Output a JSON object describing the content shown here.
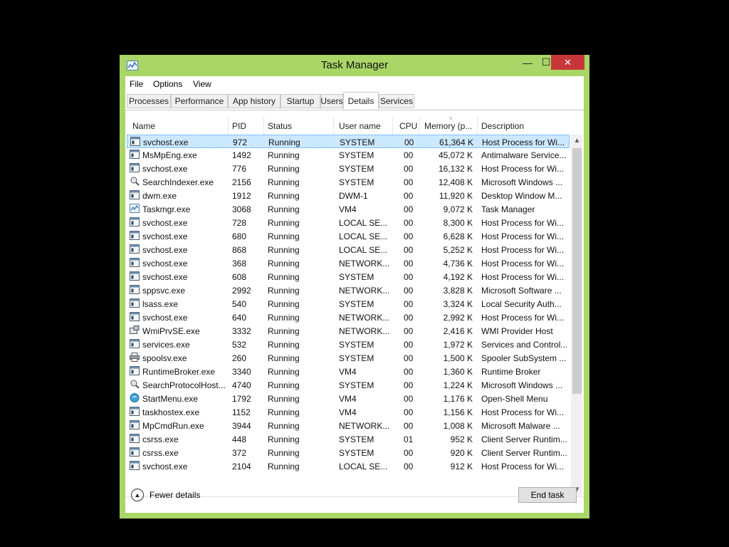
{
  "window": {
    "title": "Task Manager",
    "controls": {
      "minimize": "—",
      "maximize": "☐",
      "close": "✕"
    }
  },
  "menu": [
    "File",
    "Options",
    "View"
  ],
  "tabs": [
    "Processes",
    "Performance",
    "App history",
    "Startup",
    "Users",
    "Details",
    "Services"
  ],
  "active_tab": "Details",
  "columns": [
    "Name",
    "PID",
    "Status",
    "User name",
    "CPU",
    "Memory (p...",
    "Description"
  ],
  "rows": [
    {
      "icon": "service-host-icon",
      "name": "svchost.exe",
      "pid": "972",
      "status": "Running",
      "user": "SYSTEM",
      "cpu": "00",
      "mem": "61,364 K",
      "desc": "Host Process for Wi..."
    },
    {
      "icon": "service-host-icon",
      "name": "MsMpEng.exe",
      "pid": "1492",
      "status": "Running",
      "user": "SYSTEM",
      "cpu": "00",
      "mem": "45,072 K",
      "desc": "Antimalware Service..."
    },
    {
      "icon": "service-host-icon",
      "name": "svchost.exe",
      "pid": "776",
      "status": "Running",
      "user": "SYSTEM",
      "cpu": "00",
      "mem": "16,132 K",
      "desc": "Host Process for Wi..."
    },
    {
      "icon": "search-indexer-icon",
      "name": "SearchIndexer.exe",
      "pid": "2156",
      "status": "Running",
      "user": "SYSTEM",
      "cpu": "00",
      "mem": "12,408 K",
      "desc": "Microsoft Windows ..."
    },
    {
      "icon": "service-host-icon",
      "name": "dwm.exe",
      "pid": "1912",
      "status": "Running",
      "user": "DWM-1",
      "cpu": "00",
      "mem": "11,920 K",
      "desc": "Desktop Window M..."
    },
    {
      "icon": "task-manager-icon",
      "name": "Taskmgr.exe",
      "pid": "3068",
      "status": "Running",
      "user": "VM4",
      "cpu": "00",
      "mem": "9,072 K",
      "desc": "Task Manager"
    },
    {
      "icon": "service-host-icon",
      "name": "svchost.exe",
      "pid": "728",
      "status": "Running",
      "user": "LOCAL SE...",
      "cpu": "00",
      "mem": "8,300 K",
      "desc": "Host Process for Wi..."
    },
    {
      "icon": "service-host-icon",
      "name": "svchost.exe",
      "pid": "680",
      "status": "Running",
      "user": "LOCAL SE...",
      "cpu": "00",
      "mem": "6,628 K",
      "desc": "Host Process for Wi..."
    },
    {
      "icon": "service-host-icon",
      "name": "svchost.exe",
      "pid": "868",
      "status": "Running",
      "user": "LOCAL SE...",
      "cpu": "00",
      "mem": "5,252 K",
      "desc": "Host Process for Wi..."
    },
    {
      "icon": "service-host-icon",
      "name": "svchost.exe",
      "pid": "368",
      "status": "Running",
      "user": "NETWORK...",
      "cpu": "00",
      "mem": "4,736 K",
      "desc": "Host Process for Wi..."
    },
    {
      "icon": "service-host-icon",
      "name": "svchost.exe",
      "pid": "608",
      "status": "Running",
      "user": "SYSTEM",
      "cpu": "00",
      "mem": "4,192 K",
      "desc": "Host Process for Wi..."
    },
    {
      "icon": "service-host-icon",
      "name": "sppsvc.exe",
      "pid": "2992",
      "status": "Running",
      "user": "NETWORK...",
      "cpu": "00",
      "mem": "3,828 K",
      "desc": "Microsoft Software ..."
    },
    {
      "icon": "service-host-icon",
      "name": "lsass.exe",
      "pid": "540",
      "status": "Running",
      "user": "SYSTEM",
      "cpu": "00",
      "mem": "3,324 K",
      "desc": "Local Security Auth..."
    },
    {
      "icon": "service-host-icon",
      "name": "svchost.exe",
      "pid": "640",
      "status": "Running",
      "user": "NETWORK...",
      "cpu": "00",
      "mem": "2,992 K",
      "desc": "Host Process for Wi..."
    },
    {
      "icon": "wmi-provider-icon",
      "name": "WmiPrvSE.exe",
      "pid": "3332",
      "status": "Running",
      "user": "NETWORK...",
      "cpu": "00",
      "mem": "2,416 K",
      "desc": "WMI Provider Host"
    },
    {
      "icon": "service-host-icon",
      "name": "services.exe",
      "pid": "532",
      "status": "Running",
      "user": "SYSTEM",
      "cpu": "00",
      "mem": "1,972 K",
      "desc": "Services and Control..."
    },
    {
      "icon": "printer-icon",
      "name": "spoolsv.exe",
      "pid": "260",
      "status": "Running",
      "user": "SYSTEM",
      "cpu": "00",
      "mem": "1,500 K",
      "desc": "Spooler SubSystem ..."
    },
    {
      "icon": "service-host-icon",
      "name": "RuntimeBroker.exe",
      "pid": "3340",
      "status": "Running",
      "user": "VM4",
      "cpu": "00",
      "mem": "1,360 K",
      "desc": "Runtime Broker"
    },
    {
      "icon": "search-indexer-icon",
      "name": "SearchProtocolHost...",
      "pid": "4740",
      "status": "Running",
      "user": "SYSTEM",
      "cpu": "00",
      "mem": "1,224 K",
      "desc": "Microsoft Windows ..."
    },
    {
      "icon": "start-menu-icon",
      "name": "StartMenu.exe",
      "pid": "1792",
      "status": "Running",
      "user": "VM4",
      "cpu": "00",
      "mem": "1,176 K",
      "desc": "Open-Shell Menu"
    },
    {
      "icon": "service-host-icon",
      "name": "taskhostex.exe",
      "pid": "1152",
      "status": "Running",
      "user": "VM4",
      "cpu": "00",
      "mem": "1,156 K",
      "desc": "Host Process for Wi..."
    },
    {
      "icon": "service-host-icon",
      "name": "MpCmdRun.exe",
      "pid": "3944",
      "status": "Running",
      "user": "NETWORK...",
      "cpu": "00",
      "mem": "1,008 K",
      "desc": "Microsoft Malware ..."
    },
    {
      "icon": "service-host-icon",
      "name": "csrss.exe",
      "pid": "448",
      "status": "Running",
      "user": "SYSTEM",
      "cpu": "01",
      "mem": "952 K",
      "desc": "Client Server Runtim..."
    },
    {
      "icon": "service-host-icon",
      "name": "csrss.exe",
      "pid": "372",
      "status": "Running",
      "user": "SYSTEM",
      "cpu": "00",
      "mem": "920 K",
      "desc": "Client Server Runtim..."
    },
    {
      "icon": "service-host-icon",
      "name": "svchost.exe",
      "pid": "2104",
      "status": "Running",
      "user": "LOCAL SE...",
      "cpu": "00",
      "mem": "912 K",
      "desc": "Host Process for Wi..."
    }
  ],
  "selected_row": 0,
  "footer": {
    "fewer_details": "Fewer details",
    "end_task": "End task"
  },
  "colors": {
    "frame": "#a9d666",
    "close": "#c7373a",
    "selection": "#cce8ff"
  }
}
